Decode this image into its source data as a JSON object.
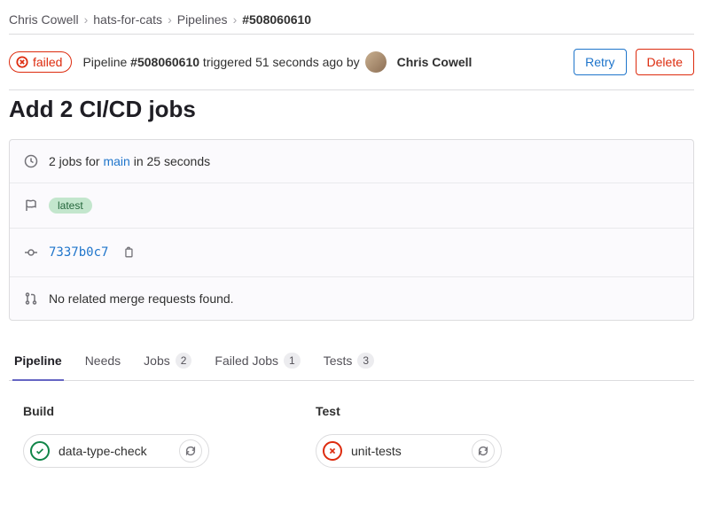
{
  "breadcrumbs": {
    "owner": "Chris Cowell",
    "project": "hats-for-cats",
    "section": "Pipelines",
    "current": "#508060610"
  },
  "status": {
    "label": "failed"
  },
  "header": {
    "pipeline_prefix": "Pipeline ",
    "pipeline_id": "#508060610",
    "triggered_text": " triggered 51 seconds ago by",
    "author": "Chris Cowell",
    "retry_label": "Retry",
    "delete_label": "Delete"
  },
  "title": "Add 2 CI/CD jobs",
  "meta": {
    "jobs_text_pre": "2 jobs for ",
    "branch": "main",
    "jobs_text_post": " in 25 seconds",
    "tag": "latest",
    "commit_sha": "7337b0c7",
    "mr_text": "No related merge requests found."
  },
  "tabs": {
    "pipeline": "Pipeline",
    "needs": "Needs",
    "jobs": "Jobs",
    "jobs_count": "2",
    "failed": "Failed Jobs",
    "failed_count": "1",
    "tests": "Tests",
    "tests_count": "3"
  },
  "stages": {
    "build": {
      "name": "Build",
      "job": "data-type-check"
    },
    "test": {
      "name": "Test",
      "job": "unit-tests"
    }
  }
}
